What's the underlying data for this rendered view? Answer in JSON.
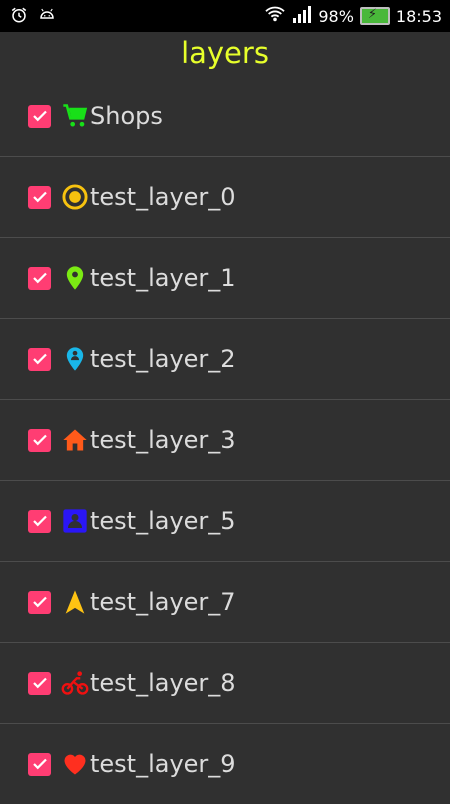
{
  "status_bar": {
    "battery_percent": "98%",
    "time": "18:53"
  },
  "title": "layers",
  "layers": [
    {
      "label": "Shops",
      "checked": true,
      "icon": "cart-icon",
      "color": "#18e018"
    },
    {
      "label": "test_layer_0",
      "checked": true,
      "icon": "target-icon",
      "color": "#f7c20f"
    },
    {
      "label": "test_layer_1",
      "checked": true,
      "icon": "map-pin-icon",
      "color": "#7bea13"
    },
    {
      "label": "test_layer_2",
      "checked": true,
      "icon": "person-pin-icon",
      "color": "#19b7e9"
    },
    {
      "label": "test_layer_3",
      "checked": true,
      "icon": "home-icon",
      "color": "#ff5a1a"
    },
    {
      "label": "test_layer_5",
      "checked": true,
      "icon": "contact-card-icon",
      "color": "#2a16f7"
    },
    {
      "label": "test_layer_7",
      "checked": true,
      "icon": "navigation-arrow-icon",
      "color": "#ffc313"
    },
    {
      "label": "test_layer_8",
      "checked": true,
      "icon": "bicycle-icon",
      "color": "#f01010"
    },
    {
      "label": "test_layer_9",
      "checked": true,
      "icon": "heart-icon",
      "color": "#ff2f1f"
    }
  ]
}
